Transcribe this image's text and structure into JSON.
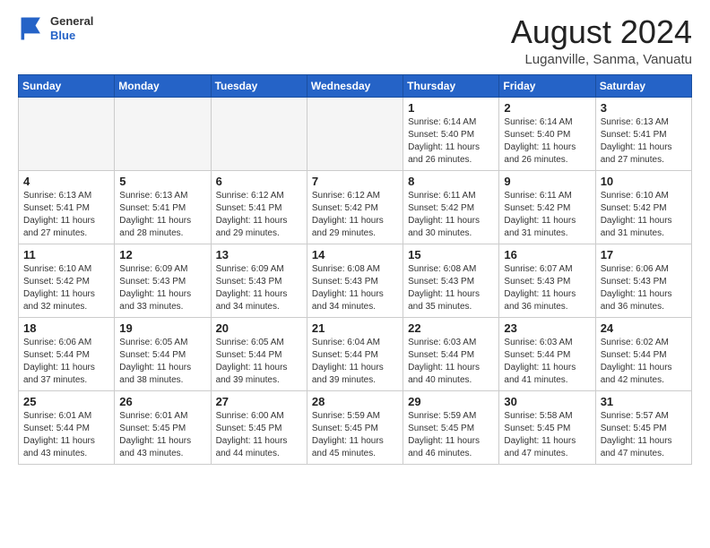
{
  "header": {
    "logo_general": "General",
    "logo_blue": "Blue",
    "month_year": "August 2024",
    "location": "Luganville, Sanma, Vanuatu"
  },
  "days_of_week": [
    "Sunday",
    "Monday",
    "Tuesday",
    "Wednesday",
    "Thursday",
    "Friday",
    "Saturday"
  ],
  "weeks": [
    [
      {
        "day": "",
        "info": ""
      },
      {
        "day": "",
        "info": ""
      },
      {
        "day": "",
        "info": ""
      },
      {
        "day": "",
        "info": ""
      },
      {
        "day": "1",
        "info": "Sunrise: 6:14 AM\nSunset: 5:40 PM\nDaylight: 11 hours\nand 26 minutes."
      },
      {
        "day": "2",
        "info": "Sunrise: 6:14 AM\nSunset: 5:40 PM\nDaylight: 11 hours\nand 26 minutes."
      },
      {
        "day": "3",
        "info": "Sunrise: 6:13 AM\nSunset: 5:41 PM\nDaylight: 11 hours\nand 27 minutes."
      }
    ],
    [
      {
        "day": "4",
        "info": "Sunrise: 6:13 AM\nSunset: 5:41 PM\nDaylight: 11 hours\nand 27 minutes."
      },
      {
        "day": "5",
        "info": "Sunrise: 6:13 AM\nSunset: 5:41 PM\nDaylight: 11 hours\nand 28 minutes."
      },
      {
        "day": "6",
        "info": "Sunrise: 6:12 AM\nSunset: 5:41 PM\nDaylight: 11 hours\nand 29 minutes."
      },
      {
        "day": "7",
        "info": "Sunrise: 6:12 AM\nSunset: 5:42 PM\nDaylight: 11 hours\nand 29 minutes."
      },
      {
        "day": "8",
        "info": "Sunrise: 6:11 AM\nSunset: 5:42 PM\nDaylight: 11 hours\nand 30 minutes."
      },
      {
        "day": "9",
        "info": "Sunrise: 6:11 AM\nSunset: 5:42 PM\nDaylight: 11 hours\nand 31 minutes."
      },
      {
        "day": "10",
        "info": "Sunrise: 6:10 AM\nSunset: 5:42 PM\nDaylight: 11 hours\nand 31 minutes."
      }
    ],
    [
      {
        "day": "11",
        "info": "Sunrise: 6:10 AM\nSunset: 5:42 PM\nDaylight: 11 hours\nand 32 minutes."
      },
      {
        "day": "12",
        "info": "Sunrise: 6:09 AM\nSunset: 5:43 PM\nDaylight: 11 hours\nand 33 minutes."
      },
      {
        "day": "13",
        "info": "Sunrise: 6:09 AM\nSunset: 5:43 PM\nDaylight: 11 hours\nand 34 minutes."
      },
      {
        "day": "14",
        "info": "Sunrise: 6:08 AM\nSunset: 5:43 PM\nDaylight: 11 hours\nand 34 minutes."
      },
      {
        "day": "15",
        "info": "Sunrise: 6:08 AM\nSunset: 5:43 PM\nDaylight: 11 hours\nand 35 minutes."
      },
      {
        "day": "16",
        "info": "Sunrise: 6:07 AM\nSunset: 5:43 PM\nDaylight: 11 hours\nand 36 minutes."
      },
      {
        "day": "17",
        "info": "Sunrise: 6:06 AM\nSunset: 5:43 PM\nDaylight: 11 hours\nand 36 minutes."
      }
    ],
    [
      {
        "day": "18",
        "info": "Sunrise: 6:06 AM\nSunset: 5:44 PM\nDaylight: 11 hours\nand 37 minutes."
      },
      {
        "day": "19",
        "info": "Sunrise: 6:05 AM\nSunset: 5:44 PM\nDaylight: 11 hours\nand 38 minutes."
      },
      {
        "day": "20",
        "info": "Sunrise: 6:05 AM\nSunset: 5:44 PM\nDaylight: 11 hours\nand 39 minutes."
      },
      {
        "day": "21",
        "info": "Sunrise: 6:04 AM\nSunset: 5:44 PM\nDaylight: 11 hours\nand 39 minutes."
      },
      {
        "day": "22",
        "info": "Sunrise: 6:03 AM\nSunset: 5:44 PM\nDaylight: 11 hours\nand 40 minutes."
      },
      {
        "day": "23",
        "info": "Sunrise: 6:03 AM\nSunset: 5:44 PM\nDaylight: 11 hours\nand 41 minutes."
      },
      {
        "day": "24",
        "info": "Sunrise: 6:02 AM\nSunset: 5:44 PM\nDaylight: 11 hours\nand 42 minutes."
      }
    ],
    [
      {
        "day": "25",
        "info": "Sunrise: 6:01 AM\nSunset: 5:44 PM\nDaylight: 11 hours\nand 43 minutes."
      },
      {
        "day": "26",
        "info": "Sunrise: 6:01 AM\nSunset: 5:45 PM\nDaylight: 11 hours\nand 43 minutes."
      },
      {
        "day": "27",
        "info": "Sunrise: 6:00 AM\nSunset: 5:45 PM\nDaylight: 11 hours\nand 44 minutes."
      },
      {
        "day": "28",
        "info": "Sunrise: 5:59 AM\nSunset: 5:45 PM\nDaylight: 11 hours\nand 45 minutes."
      },
      {
        "day": "29",
        "info": "Sunrise: 5:59 AM\nSunset: 5:45 PM\nDaylight: 11 hours\nand 46 minutes."
      },
      {
        "day": "30",
        "info": "Sunrise: 5:58 AM\nSunset: 5:45 PM\nDaylight: 11 hours\nand 47 minutes."
      },
      {
        "day": "31",
        "info": "Sunrise: 5:57 AM\nSunset: 5:45 PM\nDaylight: 11 hours\nand 47 minutes."
      }
    ]
  ]
}
